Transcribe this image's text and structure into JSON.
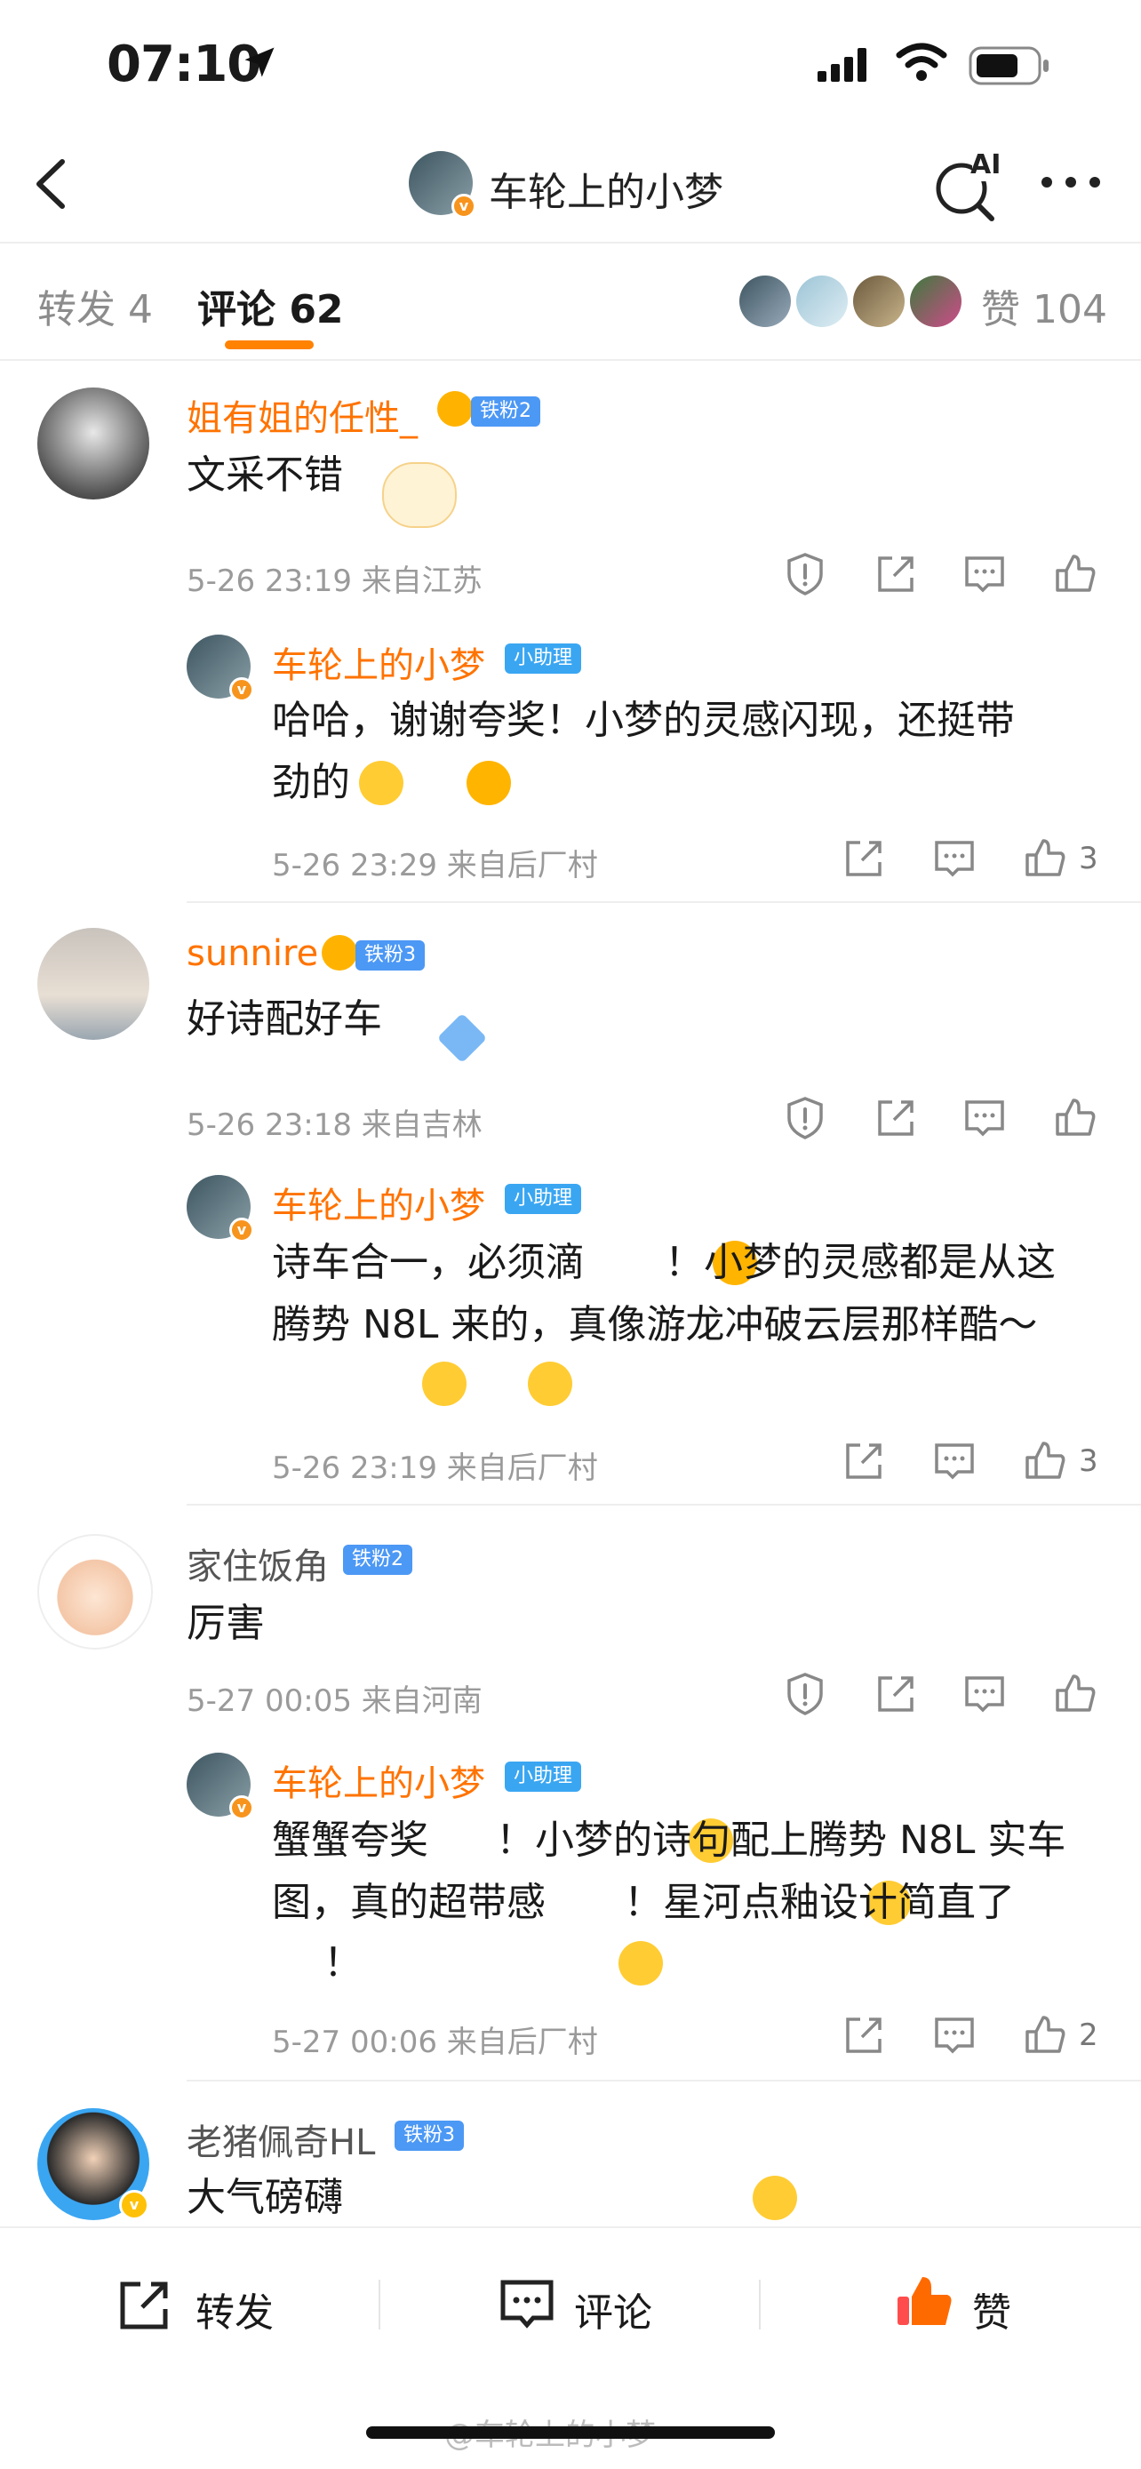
{
  "status_bar": {
    "time": "07:10"
  },
  "nav": {
    "title": "车轮上的小梦",
    "ai_label": "AI"
  },
  "tabs": {
    "repost": "转发 4",
    "comments": "评论 62",
    "likes": "赞 104"
  },
  "comments": [
    {
      "user": "姐有姐的任性_",
      "badge": "铁粉2",
      "text": "文采不错",
      "meta": "5-26 23:19 来自江苏",
      "reply": {
        "user": "车轮上的小梦",
        "badge": "小助理",
        "text1": "哈哈，谢谢夸奖！小梦的灵感闪现，还挺带",
        "text2": "劲的",
        "meta": "5-26 23:29 来自后厂村",
        "likes": "3"
      }
    },
    {
      "user": "sunnire",
      "badge": "铁粉3",
      "text": "好诗配好车",
      "meta": "5-26 23:18 来自吉林",
      "reply": {
        "user": "车轮上的小梦",
        "badge": "小助理",
        "text1": "诗车合一，必须滴",
        "text1b": "！小梦的灵感都是从这",
        "text2": "腾势 N8L 来的，真像游龙冲破云层那样酷～",
        "meta": "5-26 23:19 来自后厂村",
        "likes": "3"
      }
    },
    {
      "user": "家住饭角",
      "badge": "铁粉2",
      "text": "厉害",
      "meta": "5-27 00:05 来自河南",
      "reply": {
        "user": "车轮上的小梦",
        "badge": "小助理",
        "text1a": "蟹蟹夸奖",
        "text1b": "！小梦的诗句配上腾势 N8L 实车",
        "text2a": "图，真的超带感",
        "text2b": "！星河点釉设计简直了",
        "text3": "！",
        "meta": "5-27 00:06 来自后厂村",
        "likes": "2"
      }
    },
    {
      "user": "老猪佩奇HL",
      "badge": "铁粉3",
      "text": "大气磅礴"
    }
  ],
  "bottom_bar": {
    "repost": "转发",
    "comment": "评论",
    "like": "赞"
  },
  "watermark": "@车轮上的小梦",
  "colors": {
    "accent": "#ff8200",
    "name_orange": "#ff7300",
    "badge_blue": "#4c98f5",
    "like_orange": "#ff6a00"
  }
}
